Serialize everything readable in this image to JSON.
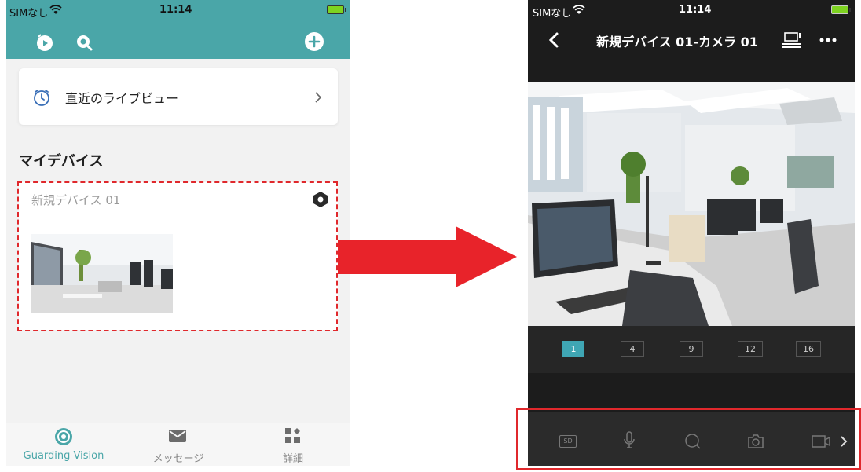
{
  "left": {
    "status": {
      "carrier": "SIMなし",
      "time": "11:14"
    },
    "recent_liveview_label": "直近のライブビュー",
    "section_title": "マイデバイス",
    "device_name": "新規デバイス 01",
    "tabs": [
      {
        "label": "Guarding Vision",
        "active": true
      },
      {
        "label": "メッセージ",
        "active": false
      },
      {
        "label": "詳細",
        "active": false
      }
    ]
  },
  "right": {
    "status": {
      "carrier": "SIMなし",
      "time": "11:14"
    },
    "title": "新規デバイス 01-カメラ 01",
    "split_options": [
      "1",
      "4",
      "9",
      "12",
      "16"
    ],
    "split_selected": "1",
    "controls": [
      {
        "label": "SD",
        "icon": "sd-quality-icon"
      },
      {
        "icon": "microphone-icon"
      },
      {
        "icon": "ptz-icon"
      },
      {
        "icon": "capture-icon"
      },
      {
        "icon": "record-icon"
      }
    ]
  },
  "colors": {
    "header_teal": "#4aa6a8",
    "highlight_red": "#e0282c",
    "arrow_red": "#e8232a",
    "split_active": "#3fa6b4"
  }
}
